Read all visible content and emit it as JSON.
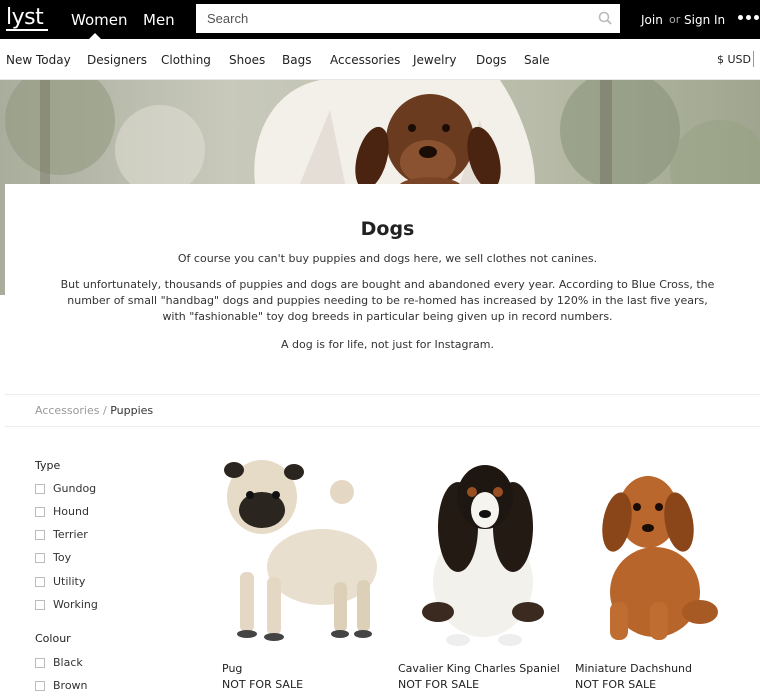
{
  "header": {
    "logo": "lyst",
    "nav": {
      "women": "Women",
      "men": "Men"
    },
    "search": {
      "placeholder": "Search",
      "value": ""
    },
    "account": {
      "join": "Join",
      "or": "or",
      "sign_in": "Sign In"
    }
  },
  "categories": [
    "New Today",
    "Designers",
    "Clothing",
    "Shoes",
    "Bags",
    "Accessories",
    "Jewelry",
    "Dogs",
    "Sale"
  ],
  "currency": "$ USD",
  "content": {
    "title": "Dogs",
    "paragraphs": [
      "Of course you can't buy puppies and dogs here, we sell clothes not canines.",
      "But unfortunately, thousands of puppies and dogs are bought and abandoned every year. According to Blue Cross, the number of small \"handbag\" dogs and puppies needing to be re-homed has increased by 120% in the last five years, with \"fashionable\" toy dog breeds in particular being given up in record numbers.",
      "A dog is for life, not just for Instagram."
    ]
  },
  "breadcrumb": {
    "parent": "Accessories",
    "separator": "/",
    "current": "Puppies"
  },
  "filters": {
    "type": {
      "heading": "Type",
      "options": [
        "Gundog",
        "Hound",
        "Terrier",
        "Toy",
        "Utility",
        "Working"
      ]
    },
    "colour": {
      "heading": "Colour",
      "options": [
        "Black",
        "Brown"
      ]
    }
  },
  "products": [
    {
      "name": "Pug",
      "price": "NOT FOR SALE",
      "image": "pug-photo"
    },
    {
      "name": "Cavalier King Charles Spaniel",
      "price": "NOT FOR SALE",
      "image": "spaniel-photo"
    },
    {
      "name": "Miniature Dachshund",
      "price": "NOT FOR SALE",
      "image": "dachshund-photo"
    }
  ],
  "colors": {
    "header_bg": "#000000",
    "text": "#222222",
    "muted": "#999999"
  }
}
